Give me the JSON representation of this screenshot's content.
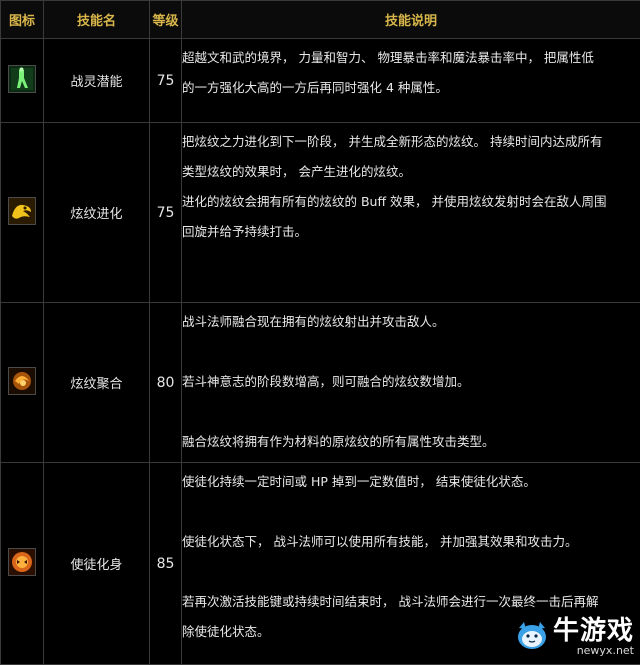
{
  "table": {
    "headers": {
      "icon": "图标",
      "name": "技能名",
      "level": "等级",
      "desc": "技能说明"
    },
    "rows": [
      {
        "icon": "green-figure-icon",
        "name": "战灵潜能",
        "level": "75",
        "lines": [
          "超越文和武的境界， 力量和智力、 物理暴击率和魔法暴击率中， 把属性低",
          "的一方强化大高的一方后再同时强化 4 种属性。"
        ]
      },
      {
        "icon": "yellow-dragon-icon",
        "name": "炫纹进化",
        "level": "75",
        "lines": [
          "把炫纹之力进化到下一阶段， 并生成全新形态的炫纹。 持续时间内达成所有",
          "类型炫纹的效果时， 会产生进化的炫纹。",
          "进化的炫纹会拥有所有的炫纹的 Buff 效果， 并使用炫纹发射时会在敌人周围",
          "回旋并给予持续打击。"
        ]
      },
      {
        "icon": "orange-orb-icon",
        "name": "炫纹聚合",
        "level": "80",
        "lines": [
          "战斗法师融合现在拥有的炫纹射出并攻击敌人。",
          "若斗神意志的阶段数增高，则可融合的炫纹数增加。",
          "融合炫纹将拥有作为材料的原炫纹的所有属性攻击类型。"
        ]
      },
      {
        "icon": "orange-beast-icon",
        "name": "使徒化身",
        "level": "85",
        "lines": [
          "使徒化持续一定时间或 HP 掉到一定数值时， 结束使徒化状态。",
          "使徒化状态下， 战斗法师可以使用所有技能， 并加强其效果和攻击力。",
          "若再次激活技能键或持续时间结束时， 战斗法师会进行一次最终一击后再解",
          "除使徒化状态。"
        ]
      }
    ]
  },
  "watermark": {
    "brand": "牛游戏",
    "site": "newyx.net"
  }
}
